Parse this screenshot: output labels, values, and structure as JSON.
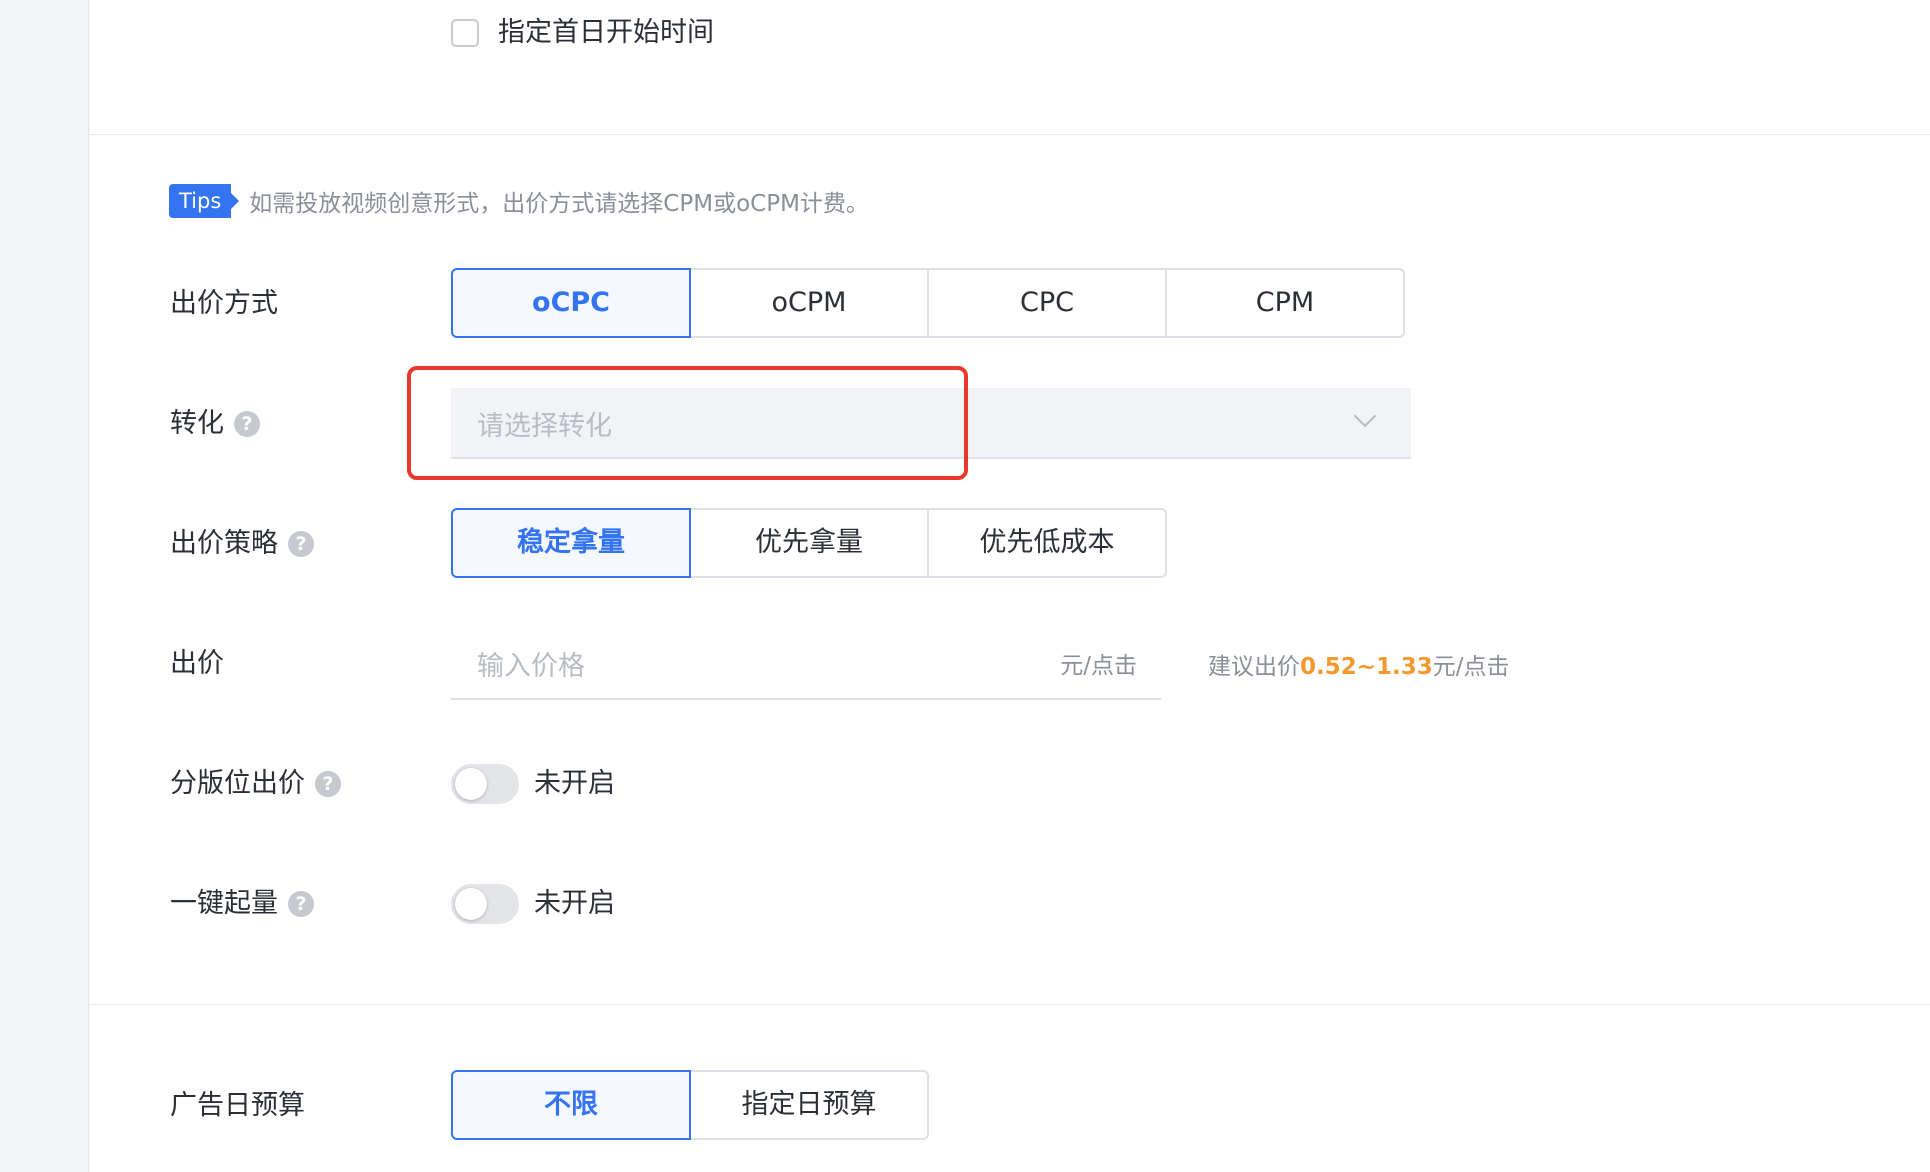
{
  "top": {
    "first_day_checkbox_label": "指定首日开始时间"
  },
  "tips": {
    "badge": "Tips",
    "text": "如需投放视频创意形式，出价方式请选择CPM或oCPM计费。"
  },
  "bid_method": {
    "label": "出价方式",
    "options": [
      "oCPC",
      "oCPM",
      "CPC",
      "CPM"
    ],
    "selected": "oCPC"
  },
  "conversion": {
    "label": "转化",
    "placeholder": "请选择转化"
  },
  "bid_strategy": {
    "label": "出价策略",
    "options": [
      "稳定拿量",
      "优先拿量",
      "优先低成本"
    ],
    "selected": "稳定拿量"
  },
  "bid": {
    "label": "出价",
    "placeholder": "输入价格",
    "unit": "元/点击",
    "suggest_prefix": "建议出价",
    "suggest_range": "0.52~1.33",
    "suggest_unit": "元/点击"
  },
  "placement_bid": {
    "label": "分版位出价",
    "status": "未开启",
    "enabled": false
  },
  "one_click_boost": {
    "label": "一键起量",
    "status": "未开启",
    "enabled": false
  },
  "daily_budget": {
    "label": "广告日预算",
    "options": [
      "不限",
      "指定日预算"
    ],
    "selected": "不限"
  },
  "colors": {
    "accent": "#3474f0",
    "highlight": "#e8392b",
    "suggest": "#f29a2e"
  }
}
